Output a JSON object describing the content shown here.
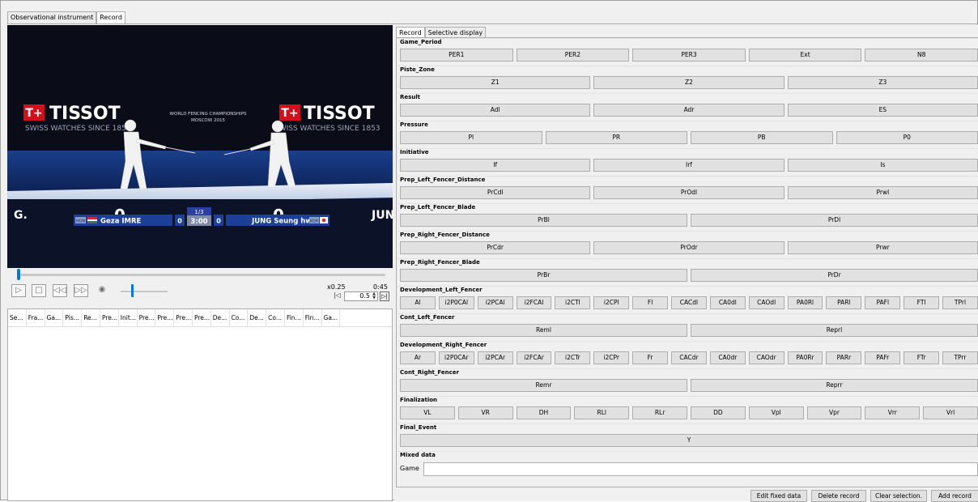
{
  "top_tabs": [
    "Observational instrument",
    "Record"
  ],
  "video": {
    "brand": "TISSOT",
    "brand_sub": "SWISS WATCHES SINCE 1853",
    "brand_sub_right": "SWISS WATCHES SINCE 1853",
    "event_line1": "WORLD FENCING CHAMPIONSHIPS",
    "event_line2": "MOSCOW 2015",
    "score_left": "0",
    "score_right": "0",
    "left_initial": "G.",
    "right_initial": "JUN",
    "fencer_left": "Geza IMRE",
    "fencer_right": "JUNG Seung hwa",
    "left_country": "HUN",
    "right_country": "KOR",
    "small_score_left": "0",
    "small_score_right": "0",
    "period": "1/3",
    "clock": "3:00"
  },
  "player": {
    "speed": "x0.25",
    "time": "0:45",
    "speed_value": "0.5",
    "progress_fraction": 0.01,
    "volume_fraction": 0.27
  },
  "table_columns": [
    "Se...",
    "Fra...",
    "Ga...",
    "Pis...",
    "Re...",
    "Pre...",
    "Init...",
    "Pre...",
    "Pre...",
    "Pre...",
    "Pre...",
    "De...",
    "Co...",
    "De...",
    "Co...",
    "Fin...",
    "Fin...",
    "Ga..."
  ],
  "right_tabs": [
    "Record",
    "Selective display"
  ],
  "sections": [
    {
      "title": "Game_Period",
      "buttons": [
        "PER1",
        "PER2",
        "PER3",
        "Ext",
        "N8"
      ]
    },
    {
      "title": "Piste_Zone",
      "buttons": [
        "Z1",
        "Z2",
        "Z3"
      ]
    },
    {
      "title": "Result",
      "buttons": [
        "Adl",
        "Adr",
        "ES"
      ]
    },
    {
      "title": "Pressure",
      "buttons": [
        "Pl",
        "PR",
        "PB",
        "P0"
      ]
    },
    {
      "title": "Initiative",
      "buttons": [
        "If",
        "Irf",
        "Is"
      ]
    },
    {
      "title": "Prep_Left_Fencer_Distance",
      "buttons": [
        "PrCdl",
        "PrOdl",
        "Prwl"
      ]
    },
    {
      "title": "Prep_Left_Fencer_Blade",
      "buttons": [
        "PrBl",
        "PrDl"
      ]
    },
    {
      "title": "Prep_Right_Fencer_Distance",
      "buttons": [
        "PrCdr",
        "PrOdr",
        "Prwr"
      ]
    },
    {
      "title": "Prep_Right_Fencer_Blade",
      "buttons": [
        "PrBr",
        "PrDr"
      ]
    },
    {
      "title": "Development_Left_Fencer",
      "buttons": [
        "Al",
        "i2P0CAl",
        "i2PCAl",
        "i2FCAl",
        "i2CTl",
        "i2CPl",
        "Fl",
        "CACdl",
        "CA0dl",
        "CAOdl",
        "PA0Rl",
        "PARl",
        "PAFl",
        "FTl",
        "TPrl"
      ]
    },
    {
      "title": "Cont_Left_Fencer",
      "buttons": [
        "Reml",
        "Reprl"
      ]
    },
    {
      "title": "Development_Right_Fencer",
      "buttons": [
        "Ar",
        "i2P0CAr",
        "i2PCAr",
        "i2FCAr",
        "i2CTr",
        "i2CPr",
        "Fr",
        "CACdr",
        "CA0dr",
        "CAOdr",
        "PA0Rr",
        "PARr",
        "PAFr",
        "FTr",
        "TPrr"
      ]
    },
    {
      "title": "Cont_Right_Fencer",
      "buttons": [
        "Remr",
        "Reprr"
      ]
    },
    {
      "title": "Finalization",
      "buttons": [
        "VL",
        "VR",
        "DH",
        "RLl",
        "RLr",
        "DD",
        "Vpl",
        "Vpr",
        "Vrr",
        "Vrl"
      ]
    },
    {
      "title": "Final_Event",
      "buttons": [
        "Y"
      ]
    }
  ],
  "mixed": {
    "title": "Mixed data",
    "game_label": "Game",
    "game_value": ""
  },
  "bottom_buttons": [
    "Edit fixed data",
    "Delete record",
    "Clear selection.",
    "Add record"
  ],
  "colors": {
    "accent": "#0078d7",
    "video_bg": "#0a0d18",
    "tissot_red": "#d2101d",
    "panel_bg": "#f0f0f0"
  }
}
